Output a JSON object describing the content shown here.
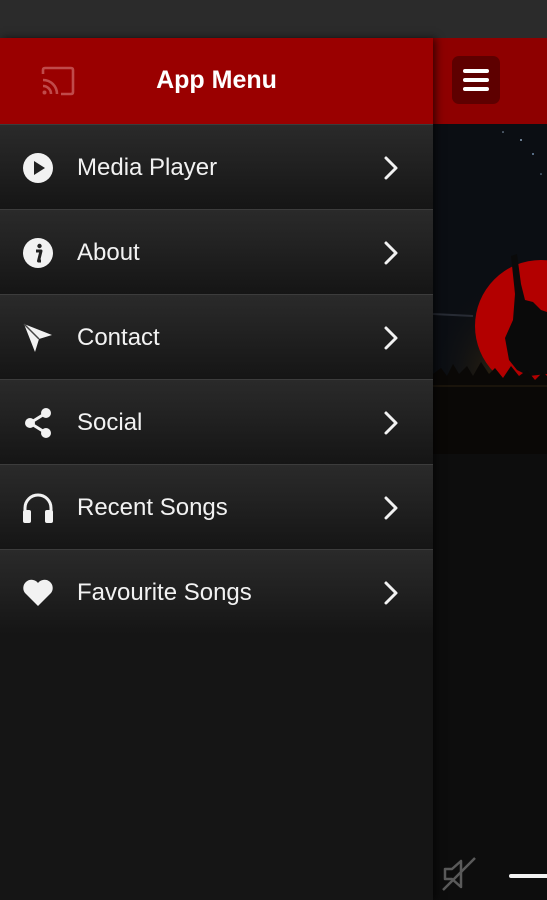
{
  "drawer": {
    "title": "App Menu",
    "items": [
      {
        "label": "Media Player",
        "icon": "play-circle-icon"
      },
      {
        "label": "About",
        "icon": "info-circle-icon"
      },
      {
        "label": "Contact",
        "icon": "send-arrow-icon"
      },
      {
        "label": "Social",
        "icon": "share-icon"
      },
      {
        "label": "Recent Songs",
        "icon": "headphones-icon"
      },
      {
        "label": "Favourite Songs",
        "icon": "heart-icon"
      }
    ]
  },
  "colors": {
    "header_red": "#9a0000",
    "menu_text": "#f2f2f2",
    "background": "#151515"
  }
}
